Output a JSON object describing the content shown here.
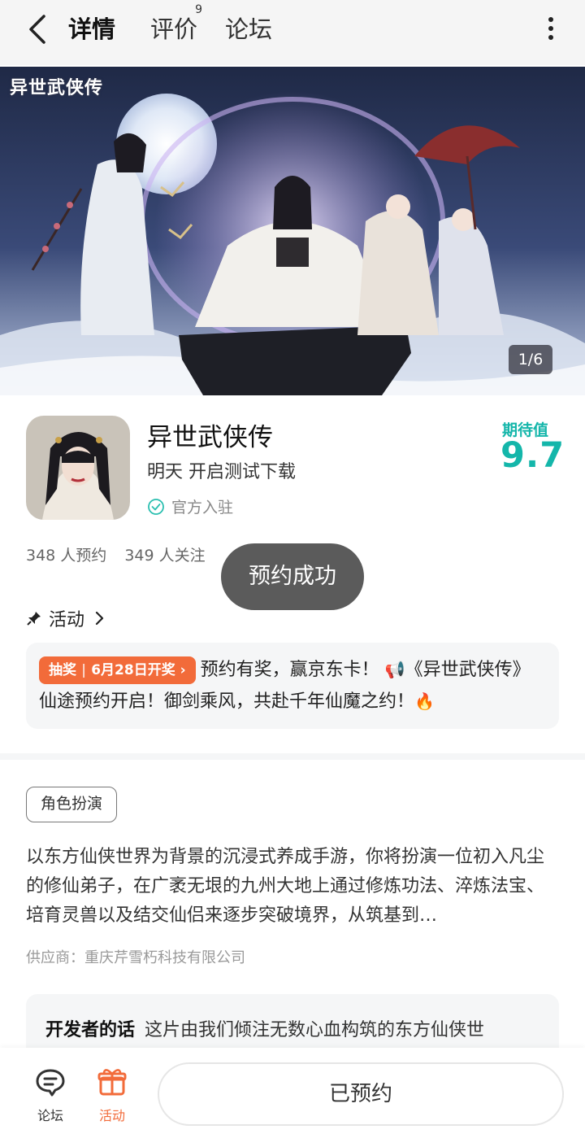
{
  "nav": {
    "tabs": [
      {
        "label": "详情"
      },
      {
        "label": "评价",
        "badge": "9"
      },
      {
        "label": "论坛"
      }
    ],
    "back_icon": "chevron-left-icon",
    "more_icon": "more-vertical-icon",
    "accent_color": "#2bd0c0"
  },
  "banner": {
    "logo_text": "异世武侠传",
    "counter": "1/6"
  },
  "app": {
    "name": "异世武侠传",
    "subtitle": "明天 开启测试下载",
    "official_label": "官方入驻",
    "expect_label": "期待值",
    "expect_score": "9.7",
    "reservations": "348 人预约",
    "followers": "349 人关注"
  },
  "toast": "预约成功",
  "activity": {
    "heading": "活动",
    "pill_type": "抽奖",
    "pill_date": "6月28日开奖",
    "text_part1": "预约有奖，赢京东卡！",
    "text_part2": "《异世武侠传》仙途预约开启！御剑乘风，共赴千年仙魔之约！",
    "emoji_1": "📢",
    "emoji_2": "🔥"
  },
  "genre_tag": "角色扮演",
  "description": "以东方仙侠世界为背景的沉浸式养成手游，你将扮演一位初入凡尘的修仙弟子，在广袤无垠的九州大地上通过修炼功法、淬炼法宝、培育灵兽以及结交仙侣来逐步突破境界，从筑基到…",
  "supplier": "供应商：重庆芹雪朽科技有限公司",
  "developer_words": {
    "label": "开发者的话",
    "text": "这片由我们倾注无数心血构筑的东方仙侠世"
  },
  "bottom": {
    "forum_label": "论坛",
    "activity_label": "活动",
    "reserved_label": "已预约",
    "activity_color": "#f26b3a"
  }
}
